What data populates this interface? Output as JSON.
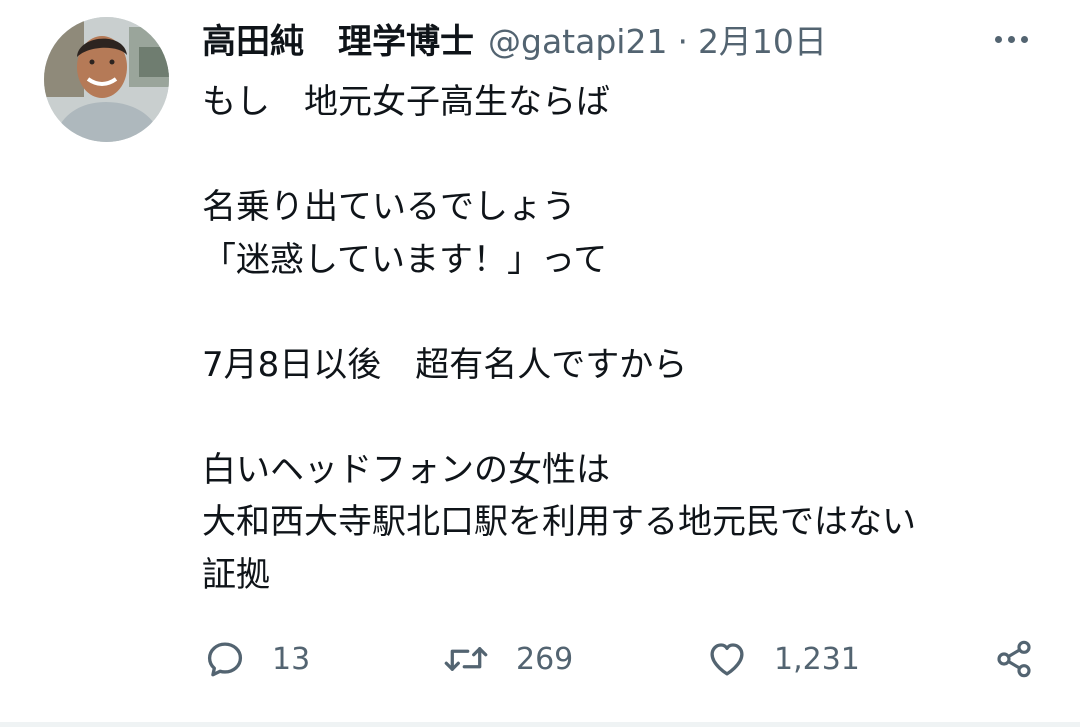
{
  "tweet": {
    "display_name": "高田純　理学博士",
    "handle": "@gatapi21",
    "separator": "·",
    "date": "2月10日",
    "lines": [
      "もし　地元女子高生ならば",
      "",
      "名乗り出ているでしょう",
      "「迷惑しています！」って",
      "",
      "7月8日以後　超有名人ですから",
      "",
      "白いヘッドフォンの女性は",
      "大和西大寺駅北口駅を利用する地元民ではない",
      "証拠"
    ]
  },
  "actions": {
    "reply_count": "13",
    "retweet_count": "269",
    "like_count": "1,231"
  },
  "icons": {
    "more": "more-horizontal-icon",
    "reply": "comment-bubble-icon",
    "retweet": "retweet-arrows-icon",
    "like": "heart-outline-icon",
    "share": "share-nodes-icon"
  },
  "colors": {
    "text": "#0f1419",
    "secondary": "#536471",
    "divider": "#eff3f4"
  }
}
